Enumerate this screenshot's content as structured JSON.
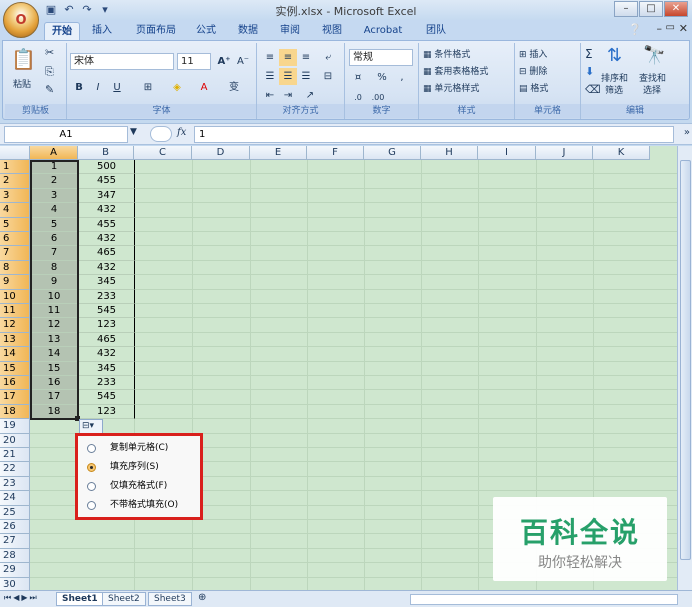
{
  "window": {
    "title": "实例.xlsx - Microsoft Excel",
    "office_button": "O"
  },
  "ribbon_tabs": [
    "开始",
    "插入",
    "页面布局",
    "公式",
    "数据",
    "审阅",
    "视图",
    "Acrobat",
    "团队"
  ],
  "ribbon": {
    "clipboard": {
      "paste": "粘贴",
      "label": "剪贴板"
    },
    "font": {
      "name": "宋体",
      "size": "11",
      "label": "字体"
    },
    "alignment": {
      "label": "对齐方式"
    },
    "number": {
      "format": "常规",
      "label": "数字"
    },
    "styles": {
      "conditional": "条件格式",
      "table": "套用表格格式",
      "cell": "单元格样式",
      "label": "样式"
    },
    "cells": {
      "insert": "插入",
      "delete": "删除",
      "format": "格式",
      "label": "单元格"
    },
    "editing": {
      "sort": "排序和",
      "sort2": "筛选",
      "find": "查找和",
      "find2": "选择",
      "label": "编辑"
    }
  },
  "formula_bar": {
    "name_box": "A1",
    "fx": "fx",
    "value": "1"
  },
  "columns": [
    "A",
    "B",
    "C",
    "D",
    "E",
    "F",
    "G",
    "H",
    "I",
    "J",
    "K"
  ],
  "rows": [
    {
      "n": "1",
      "a": "1",
      "b": "500"
    },
    {
      "n": "2",
      "a": "2",
      "b": "455"
    },
    {
      "n": "3",
      "a": "3",
      "b": "347"
    },
    {
      "n": "4",
      "a": "4",
      "b": "432"
    },
    {
      "n": "5",
      "a": "5",
      "b": "455"
    },
    {
      "n": "6",
      "a": "6",
      "b": "432"
    },
    {
      "n": "7",
      "a": "7",
      "b": "465"
    },
    {
      "n": "8",
      "a": "8",
      "b": "432"
    },
    {
      "n": "9",
      "a": "9",
      "b": "345"
    },
    {
      "n": "10",
      "a": "10",
      "b": "233"
    },
    {
      "n": "11",
      "a": "11",
      "b": "545"
    },
    {
      "n": "12",
      "a": "12",
      "b": "123"
    },
    {
      "n": "13",
      "a": "13",
      "b": "465"
    },
    {
      "n": "14",
      "a": "14",
      "b": "432"
    },
    {
      "n": "15",
      "a": "15",
      "b": "345"
    },
    {
      "n": "16",
      "a": "16",
      "b": "233"
    },
    {
      "n": "17",
      "a": "17",
      "b": "545"
    },
    {
      "n": "18",
      "a": "18",
      "b": "123"
    },
    {
      "n": "19",
      "a": "",
      "b": ""
    },
    {
      "n": "20",
      "a": "",
      "b": ""
    },
    {
      "n": "21",
      "a": "",
      "b": ""
    },
    {
      "n": "22",
      "a": "",
      "b": ""
    },
    {
      "n": "23",
      "a": "",
      "b": ""
    },
    {
      "n": "24",
      "a": "",
      "b": ""
    },
    {
      "n": "25",
      "a": "",
      "b": ""
    },
    {
      "n": "26",
      "a": "",
      "b": ""
    },
    {
      "n": "27",
      "a": "",
      "b": ""
    },
    {
      "n": "28",
      "a": "",
      "b": ""
    },
    {
      "n": "29",
      "a": "",
      "b": ""
    },
    {
      "n": "30",
      "a": "",
      "b": ""
    }
  ],
  "autofill_menu": {
    "items": [
      {
        "label": "复制单元格(C)",
        "selected": false
      },
      {
        "label": "填充序列(S)",
        "selected": true
      },
      {
        "label": "仅填充格式(F)",
        "selected": false
      },
      {
        "label": "不带格式填充(O)",
        "selected": false
      }
    ]
  },
  "sheets": [
    "Sheet1",
    "Sheet2",
    "Sheet3"
  ],
  "watermark": {
    "title": "百科全说",
    "subtitle": "助你轻松解决"
  },
  "colors": {
    "highlight": "#d9201c",
    "selection_header": "#f1b656",
    "grid_bg": "#cfe7cf",
    "watermark_green": "#27a06a"
  }
}
